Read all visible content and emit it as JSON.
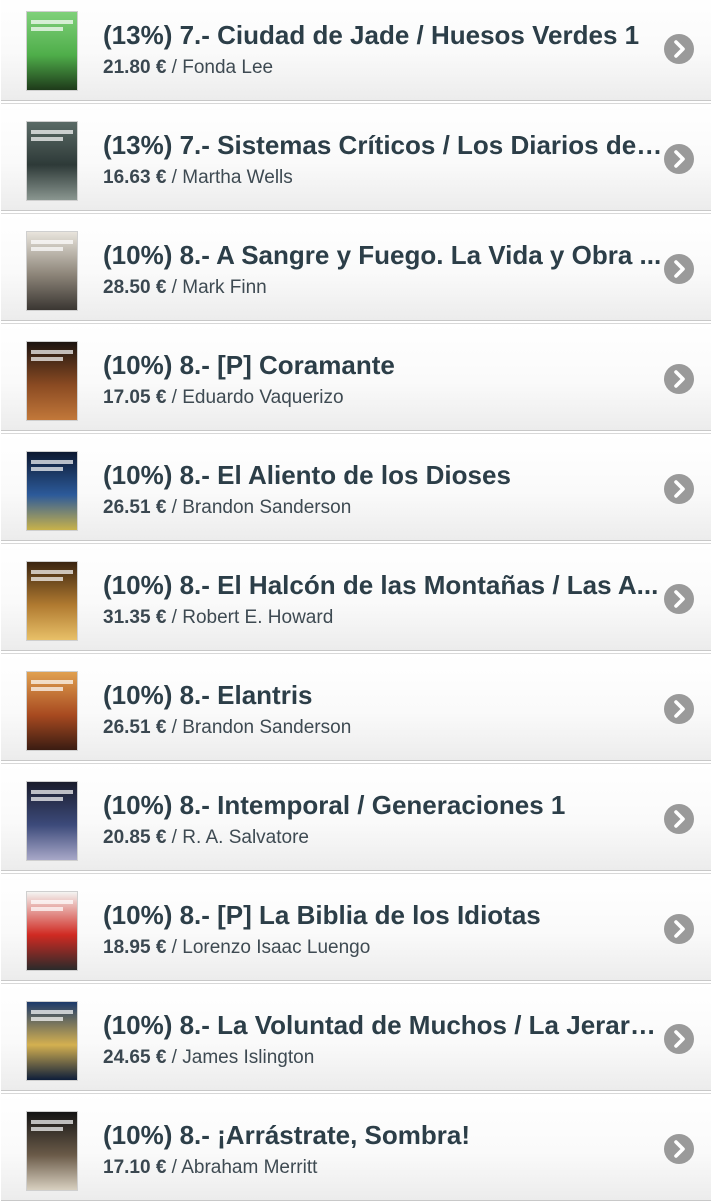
{
  "items": [
    {
      "title": "(13%) 7.- Ciudad de Jade / Huesos Verdes 1",
      "price": "21.80 €",
      "author": "Fonda Lee",
      "cover_colors": [
        "#7fd07a",
        "#4fae4a",
        "#1e3a1a"
      ]
    },
    {
      "title": "(13%) 7.- Sistemas Críticos / Los Diarios de ...",
      "price": "16.63 €",
      "author": "Martha Wells",
      "cover_colors": [
        "#5a6a66",
        "#2e3a38",
        "#8a9690"
      ]
    },
    {
      "title": "(10%) 8.- A Sangre y Fuego. La Vida y Obra ...",
      "price": "28.50 €",
      "author": "Mark Finn",
      "cover_colors": [
        "#e8e4dc",
        "#8c8478",
        "#3a3632"
      ]
    },
    {
      "title": "(10%) 8.- [P] Coramante",
      "price": "17.05 €",
      "author": "Eduardo Vaquerizo",
      "cover_colors": [
        "#1c1410",
        "#8a4a22",
        "#c2783a"
      ]
    },
    {
      "title": "(10%) 8.- El Aliento de los Dioses",
      "price": "26.51 €",
      "author": "Brandon Sanderson",
      "cover_colors": [
        "#0c1830",
        "#2c5a9a",
        "#c8b24a"
      ]
    },
    {
      "title": "(10%) 8.- El Halcón de las Montañas / Las A...",
      "price": "31.35 €",
      "author": "Robert E. Howard",
      "cover_colors": [
        "#3a2410",
        "#b07a30",
        "#e8c068"
      ]
    },
    {
      "title": "(10%) 8.- Elantris",
      "price": "26.51 €",
      "author": "Brandon Sanderson",
      "cover_colors": [
        "#e0a050",
        "#a84a20",
        "#3a1c12"
      ]
    },
    {
      "title": "(10%) 8.- Intemporal / Generaciones 1",
      "price": "20.85 €",
      "author": "R. A. Salvatore",
      "cover_colors": [
        "#1a1c2c",
        "#3c4a7a",
        "#a8a8c8"
      ]
    },
    {
      "title": "(10%) 8.- [P] La Biblia de los Idiotas",
      "price": "18.95 €",
      "author": "Lorenzo Isaac Luengo",
      "cover_colors": [
        "#f4f4f2",
        "#d02a22",
        "#2a2a2a"
      ]
    },
    {
      "title": "(10%) 8.- La Voluntad de Muchos / La Jerarq...",
      "price": "24.65 €",
      "author": "James Islington",
      "cover_colors": [
        "#1c3a6a",
        "#d4b050",
        "#0e1e3a"
      ]
    },
    {
      "title": "(10%) 8.- ¡Arrástrate, Sombra!",
      "price": "17.10 €",
      "author": "Abraham Merritt",
      "cover_colors": [
        "#141414",
        "#6a5a48",
        "#d8d0c0"
      ]
    }
  ],
  "separator": " / ",
  "chevron_icon": "chevron-right-circle-icon"
}
